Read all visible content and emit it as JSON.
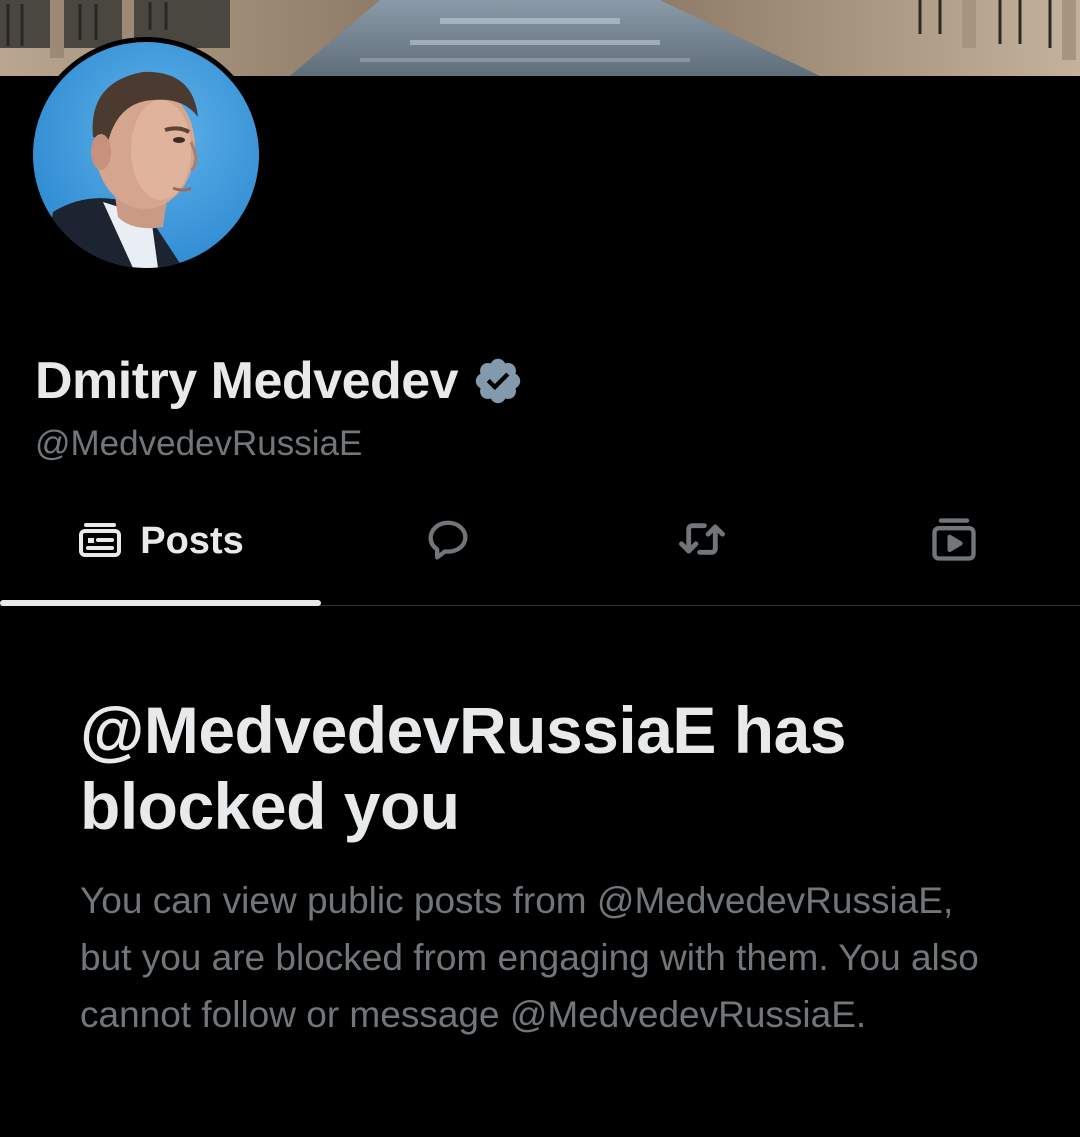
{
  "profile": {
    "display_name": "Dmitry Medvedev",
    "handle": "@MedvedevRussiaE",
    "verified": true
  },
  "tabs": [
    {
      "label": "Posts",
      "icon": "posts-icon",
      "selected": true
    },
    {
      "label": "",
      "icon": "replies-icon",
      "selected": false
    },
    {
      "label": "",
      "icon": "repost-icon",
      "selected": false
    },
    {
      "label": "",
      "icon": "media-icon",
      "selected": false
    }
  ],
  "blocked_notice": {
    "title": "@MedvedevRussiaE has blocked you",
    "description": "You can view public posts from @MedvedevRussiaE, but you are blocked from engaging with them. You also cannot follow or message @MedvedevRussiaE."
  },
  "colors": {
    "background": "#000000",
    "primary_text": "#e7e9ea",
    "secondary_text": "#71767b",
    "verified_badge": "#829aab",
    "divider": "#2f3336"
  }
}
